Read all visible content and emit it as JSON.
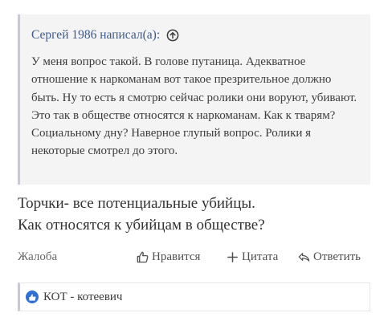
{
  "quote": {
    "author_line": "Сергей 1986 написал(а):",
    "text": "У меня вопрос такой. В голове путаница. Адекватное отношение к наркоманам вот такое презрительное должно быть. Ну то есть я смотрю сейчас ролики они воруют, убивают. Это так в обществе относятся к наркоманам. Как к тварям?Социальному дну? Наверное глупый вопрос. Ролики я некоторые смотрел до этого."
  },
  "reply": {
    "line1": "Торчки- все потенциальные убийцы.",
    "line2": "Как относятся к убийцам в обществе?"
  },
  "actions": {
    "complaint": "Жалоба",
    "like": "Нравится",
    "cite": "Цитата",
    "answer": "Ответить"
  },
  "reactions": {
    "users": "КОТ - котеевич"
  },
  "colors": {
    "quote_bg": "#f4f4f5",
    "link": "#3d5a8a",
    "like_badge": "#2f6fd6"
  }
}
